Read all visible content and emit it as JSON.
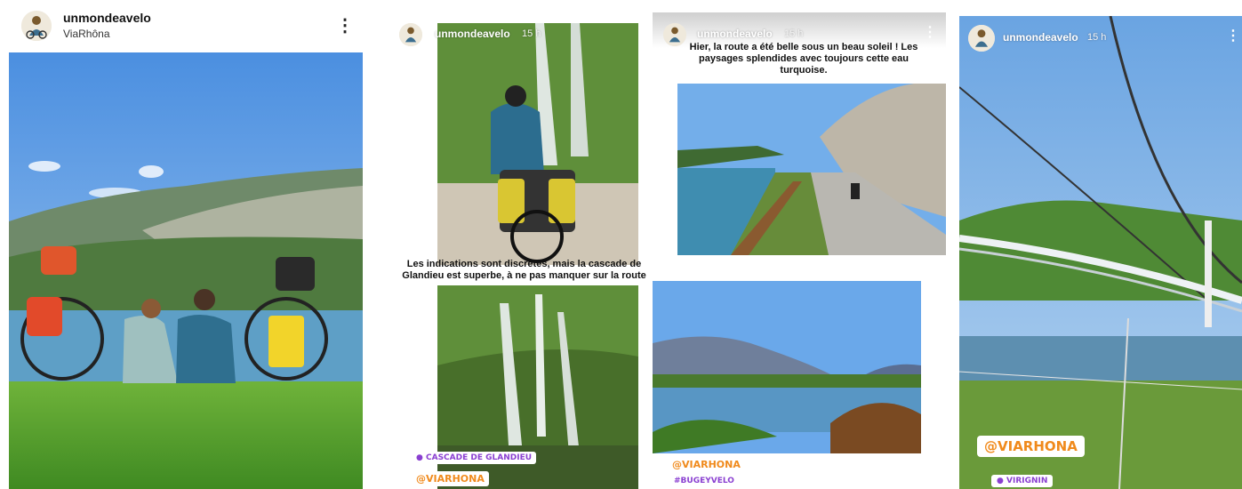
{
  "post": {
    "username": "unmondeavelo",
    "location": "ViaRhôna",
    "more_icon": "⋮"
  },
  "story1": {
    "username": "unmondeavelo",
    "time": "15 h",
    "caption": "Les indications sont discrètes, mais la cascade de Glandieu est superbe, à ne pas manquer sur la route",
    "location_tag": "CASCADE DE GLANDIEU",
    "mention_tag": "@VIARHONA"
  },
  "story2": {
    "username": "unmondeavelo",
    "time": "15 h",
    "caption": "Hier, la route a été belle sous un beau soleil ! Les paysages splendides avec toujours cette eau turquoise.",
    "mention_tag": "@VIARHONA",
    "hashtag": "#BUGEYVELO",
    "more_icon": "⋮"
  },
  "story3": {
    "username": "unmondeavelo",
    "time": "15 h",
    "mention_tag": "@VIARHONA",
    "location_tag": "VIRIGNIN",
    "more_icon": "⋮"
  },
  "colors": {
    "tag_orange": "#f08a1c",
    "tag_purple": "#8a3fd1",
    "sky": "#6aa6e6",
    "grass": "#4f9a2c",
    "water": "#5b9cc4"
  }
}
